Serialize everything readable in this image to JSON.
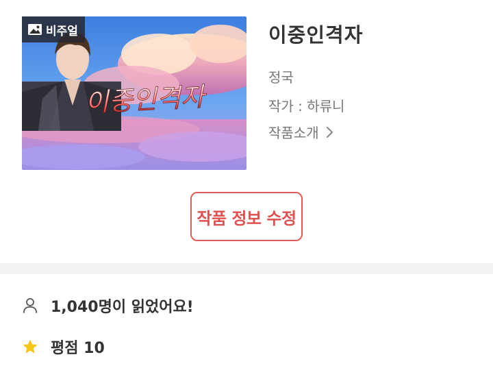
{
  "work": {
    "title": "이중인격자",
    "tag": "정국",
    "author": "작가 : 하류니",
    "intro_label": "작품소개",
    "cover": {
      "badge_label": "비주얼",
      "title_text": "이중인격자"
    }
  },
  "actions": {
    "edit_label": "작품 정보 수정"
  },
  "stats": {
    "reads": "1,040명이 읽었어요!",
    "rating": "평점 10"
  },
  "colors": {
    "accent": "#e05050",
    "star": "#f5c518",
    "divider": "#f1f2f4"
  },
  "icons": {
    "badge": "image-icon",
    "intro": "chevron-right-icon",
    "reads": "person-icon",
    "rating": "star-icon"
  }
}
